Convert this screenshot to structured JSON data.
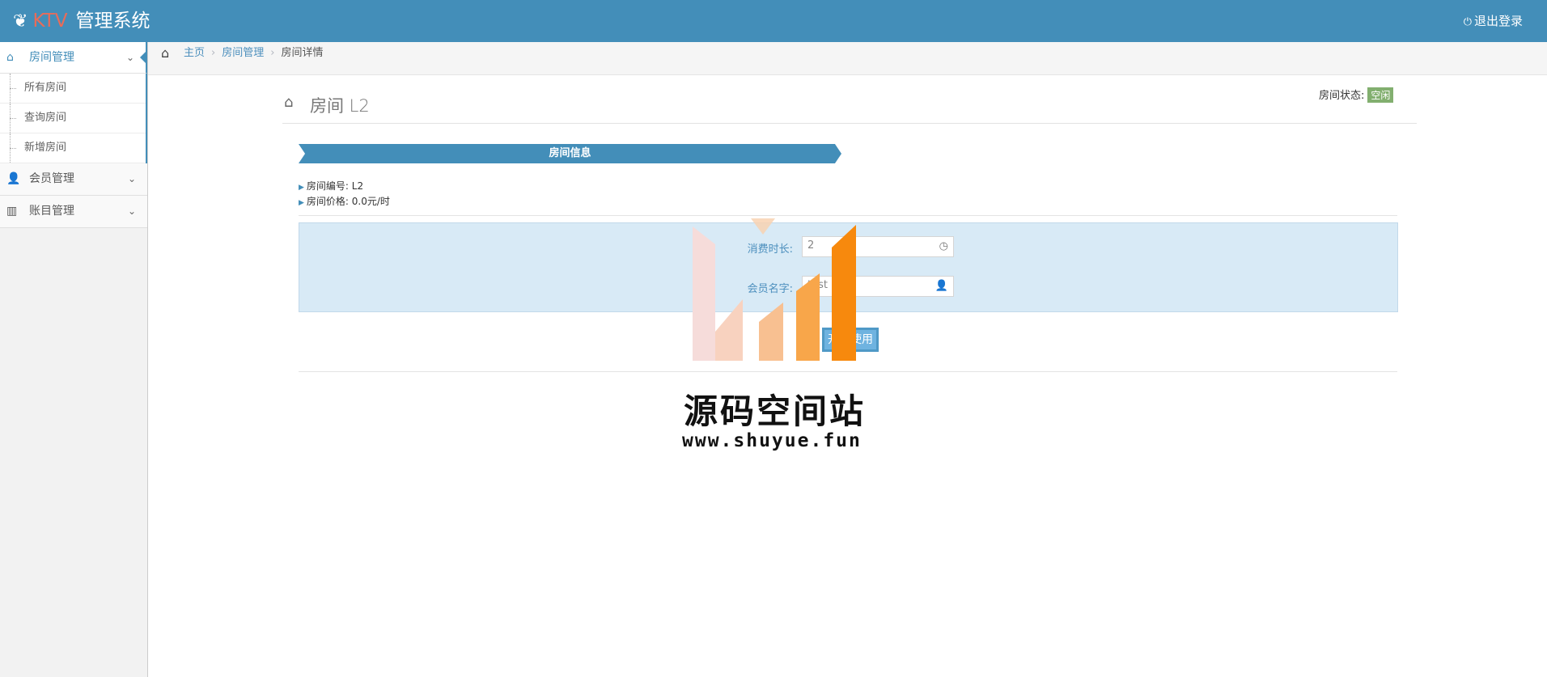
{
  "header": {
    "brand_prefix": "KTV",
    "brand_name": "管理系统",
    "logout_label": "退出登录",
    "logo_icon": "leaf-icon",
    "logout_icon": "power-icon"
  },
  "sidebar": {
    "groups": [
      {
        "label": "房间管理",
        "icon": "home-icon",
        "expanded": true,
        "items": [
          {
            "label": "所有房间"
          },
          {
            "label": "查询房间"
          },
          {
            "label": "新增房间"
          }
        ]
      },
      {
        "label": "会员管理",
        "icon": "user-icon",
        "expanded": false
      },
      {
        "label": "账目管理",
        "icon": "bar-chart-icon",
        "expanded": false
      }
    ]
  },
  "breadcrumb": {
    "items": [
      {
        "label": "主页"
      },
      {
        "label": "房间管理"
      }
    ],
    "current": "房间详情"
  },
  "page": {
    "title": "房间 L2",
    "status_label": "房间状态:",
    "status_value": "空闲",
    "status_color": "#82af6f"
  },
  "room_info": {
    "section_title": "房间信息",
    "number_label": "房间编号:",
    "number_value": "L2",
    "price_label": "房间价格:",
    "price_value": "0.0元/时"
  },
  "form": {
    "duration_label": "消费时长:",
    "duration_value": "2",
    "member_label": "会员名字:",
    "member_value": "test",
    "submit_label": "开始使用"
  },
  "watermark": {
    "title": "源码空间站",
    "url": "www.shuyue.fun"
  },
  "colors": {
    "primary": "#438eb9",
    "form_bg": "#d8eaf6",
    "button": "#6fb3e0"
  }
}
